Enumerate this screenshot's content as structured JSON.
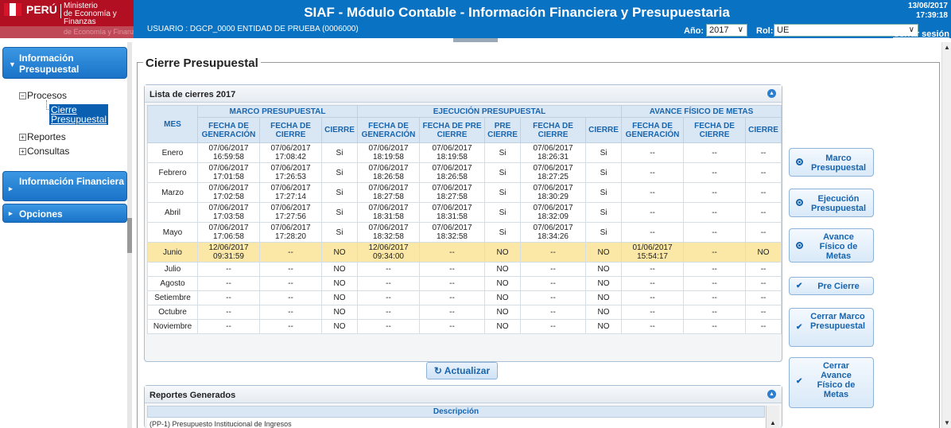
{
  "header": {
    "logo": {
      "country": "PERÚ",
      "ministry_line1": "Ministerio",
      "ministry_line2": "de Economía y Finanzas",
      "ministry_faded": "de Economía y Finanzas"
    },
    "title": "SIAF - Módulo Contable - Información Financiera y Presupuestaria",
    "user_line": "USUARIO : DGCP_0000   ENTIDAD DE PRUEBA (0006000)",
    "date": "13/06/2017",
    "time": "17:39:18",
    "logout": "Cerrar sesión",
    "year_label": "Año:",
    "year_value": "2017",
    "rol_label": "Rol:",
    "rol_value": "UE"
  },
  "sidebar": {
    "info_presupuestal": "Información Presupuestal",
    "procesos": "Procesos",
    "cierre_presupuestal_1": "Cierre",
    "cierre_presupuestal_2": "Presupuestal",
    "reportes": "Reportes",
    "consultas": "Consultas",
    "info_financiera": "Información Financiera",
    "opciones": "Opciones"
  },
  "main": {
    "page_title": "Cierre Presupuestal",
    "list_title": "Lista de cierres 2017",
    "groups": {
      "marco": "MARCO PRESUPUESTAL",
      "ejecucion": "EJECUCIÓN PRESUPUESTAL",
      "avance": "AVANCE FÍSICO DE METAS"
    },
    "col_mes": "MES",
    "cols": {
      "fecha_gen": "FECHA DE GENERACIÓN",
      "fecha_cierre": "FECHA DE CIERRE",
      "cierre": "CIERRE",
      "fecha_precierre": "FECHA DE PRE CIERRE",
      "pre_cierre": "PRE CIERRE"
    },
    "rows": [
      {
        "mes": "Enero",
        "mg": "07/06/2017 16:59:58",
        "mc": "07/06/2017 17:08:42",
        "mcierre": "Si",
        "eg": "07/06/2017 18:19:58",
        "epc": "07/06/2017 18:19:58",
        "epre": "Si",
        "ec": "07/06/2017 18:26:31",
        "ecierre": "Si",
        "ag": "--",
        "ac": "--",
        "acierre": "--"
      },
      {
        "mes": "Febrero",
        "mg": "07/06/2017 17:01:58",
        "mc": "07/06/2017 17:26:53",
        "mcierre": "Si",
        "eg": "07/06/2017 18:26:58",
        "epc": "07/06/2017 18:26:58",
        "epre": "Si",
        "ec": "07/06/2017 18:27:25",
        "ecierre": "Si",
        "ag": "--",
        "ac": "--",
        "acierre": "--"
      },
      {
        "mes": "Marzo",
        "mg": "07/06/2017 17:02:58",
        "mc": "07/06/2017 17:27:14",
        "mcierre": "Si",
        "eg": "07/06/2017 18:27:58",
        "epc": "07/06/2017 18:27:58",
        "epre": "Si",
        "ec": "07/06/2017 18:30:29",
        "ecierre": "Si",
        "ag": "--",
        "ac": "--",
        "acierre": "--"
      },
      {
        "mes": "Abril",
        "mg": "07/06/2017 17:03:58",
        "mc": "07/06/2017 17:27:56",
        "mcierre": "Si",
        "eg": "07/06/2017 18:31:58",
        "epc": "07/06/2017 18:31:58",
        "epre": "Si",
        "ec": "07/06/2017 18:32:09",
        "ecierre": "Si",
        "ag": "--",
        "ac": "--",
        "acierre": "--"
      },
      {
        "mes": "Mayo",
        "mg": "07/06/2017 17:06:58",
        "mc": "07/06/2017 17:28:20",
        "mcierre": "Si",
        "eg": "07/06/2017 18:32:58",
        "epc": "07/06/2017 18:32:58",
        "epre": "Si",
        "ec": "07/06/2017 18:34:26",
        "ecierre": "Si",
        "ag": "--",
        "ac": "--",
        "acierre": "--"
      },
      {
        "mes": "Junio",
        "mg": "12/06/2017 09:31:59",
        "mc": "--",
        "mcierre": "NO",
        "eg": "12/06/2017 09:34:00",
        "epc": "--",
        "epre": "NO",
        "ec": "--",
        "ecierre": "NO",
        "ag": "01/06/2017 15:54:17",
        "ac": "--",
        "acierre": "NO",
        "highlight": true
      },
      {
        "mes": "Julio",
        "mg": "--",
        "mc": "--",
        "mcierre": "NO",
        "eg": "--",
        "epc": "--",
        "epre": "NO",
        "ec": "--",
        "ecierre": "NO",
        "ag": "--",
        "ac": "--",
        "acierre": "--"
      },
      {
        "mes": "Agosto",
        "mg": "--",
        "mc": "--",
        "mcierre": "NO",
        "eg": "--",
        "epc": "--",
        "epre": "NO",
        "ec": "--",
        "ecierre": "NO",
        "ag": "--",
        "ac": "--",
        "acierre": "--"
      },
      {
        "mes": "Setiembre",
        "mg": "--",
        "mc": "--",
        "mcierre": "NO",
        "eg": "--",
        "epc": "--",
        "epre": "NO",
        "ec": "--",
        "ecierre": "NO",
        "ag": "--",
        "ac": "--",
        "acierre": "--"
      },
      {
        "mes": "Octubre",
        "mg": "--",
        "mc": "--",
        "mcierre": "NO",
        "eg": "--",
        "epc": "--",
        "epre": "NO",
        "ec": "--",
        "ecierre": "NO",
        "ag": "--",
        "ac": "--",
        "acierre": "--"
      },
      {
        "mes": "Noviembre",
        "mg": "--",
        "mc": "--",
        "mcierre": "NO",
        "eg": "--",
        "epc": "--",
        "epre": "NO",
        "ec": "--",
        "ecierre": "NO",
        "ag": "--",
        "ac": "--",
        "acierre": "--"
      }
    ],
    "actualizar": "Actualizar",
    "reportes_title": "Reportes Generados",
    "reportes_col": "Descripción",
    "reportes_rows": [
      "(PP-1) Presupuesto Institucional de Ingresos"
    ]
  },
  "side_buttons": {
    "marco": "Marco Presupuestal",
    "ejecucion": "Ejecución Presupuestal",
    "avance": "Avance Físico de Metas",
    "precierre": "Pre Cierre",
    "cerrar_marco": "Cerrar Marco Presupuestal",
    "cerrar_avance": "Cerrar Avance Físico de Metas"
  },
  "icons": {
    "collapse": "chevron-up-icon",
    "refresh": "refresh-icon",
    "check": "check-icon",
    "radio": "radio-icon"
  },
  "colors": {
    "header_blue": "#0a72c2",
    "logo_red": "#b30f22",
    "highlight_row": "#fbe7a6",
    "accent_text": "#1865ae"
  }
}
